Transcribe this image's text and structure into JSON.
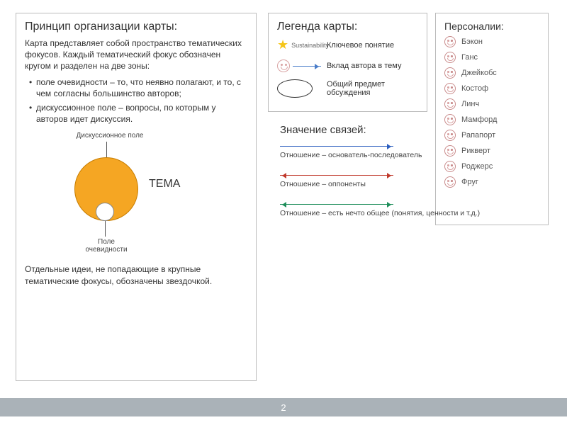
{
  "left": {
    "title": "Принцип организации карты:",
    "intro": "Карта представляет собой пространство тематических фокусов. Каждый тематический фокус обозначен кругом и разделен на две зоны:",
    "bullets": [
      "поле очевидности – то, что неявно полагают, и то, с чем согласны большинство авторов;",
      "дискуссионное поле – вопросы, по которым у авторов идет дискуссия."
    ],
    "diagram": {
      "discussion_label": "Дискуссионное поле",
      "evidence_label": "Поле очевидности",
      "theme_label": "ТЕМА"
    },
    "footer_note": "Отдельные идеи, не попадающие в крупные тематические фокусы, обозначены звездочкой."
  },
  "legend": {
    "title": "Легенда карты:",
    "star_caption": "Sustainability",
    "items": {
      "star": "Ключевое понятие",
      "face": "Вклад автора в тему",
      "oval": "Общий предмет обсуждения"
    }
  },
  "relations": {
    "title": "Значение связей:",
    "blue": "Отношение – основатель-последователь",
    "red": "Отношение – оппоненты",
    "green": "Отношение – есть нечто общее (понятия, ценности и т.д.)"
  },
  "pers": {
    "title": "Персоналии:",
    "names": [
      "Бэкон",
      "Ганс",
      "Джейкобс",
      "Костоф",
      "Линч",
      "Мамфорд",
      "Рапапорт",
      "Рикверт",
      "Роджерс",
      "Фруг"
    ]
  },
  "page_number": "2"
}
